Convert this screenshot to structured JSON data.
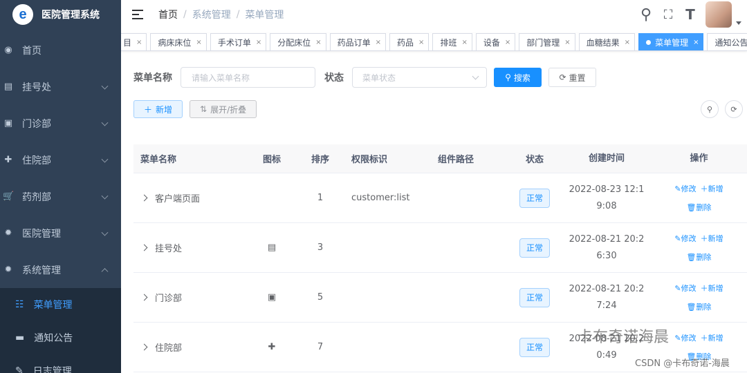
{
  "app": {
    "title": "医院管理系统",
    "logo_letter": "e"
  },
  "sidebar": {
    "items": [
      {
        "icon": "dashboard-icon",
        "glyph": "◉",
        "label": "首页"
      },
      {
        "icon": "register-icon",
        "glyph": "▤",
        "label": "挂号处"
      },
      {
        "icon": "clinic-icon",
        "glyph": "▣",
        "label": "门诊部"
      },
      {
        "icon": "hospital-icon",
        "glyph": "✚",
        "label": "住院部"
      },
      {
        "icon": "cart-icon",
        "glyph": "🛒",
        "label": "药剂部"
      },
      {
        "icon": "gear-icon",
        "glyph": "✹",
        "label": "医院管理"
      },
      {
        "icon": "gear-icon",
        "glyph": "✹",
        "label": "系统管理"
      }
    ],
    "sub_items": [
      {
        "icon": "tree-table-icon",
        "glyph": "☷",
        "label": "菜单管理"
      },
      {
        "icon": "message-icon",
        "glyph": "▬",
        "label": "通知公告"
      },
      {
        "icon": "edit-icon",
        "glyph": "✎",
        "label": "日志管理"
      }
    ]
  },
  "header": {
    "breadcrumb": [
      "首页",
      "系统管理",
      "菜单管理"
    ],
    "icons": {
      "search": "⚲",
      "fullscreen": "⛶",
      "fontsize": "T"
    }
  },
  "tags": [
    "目",
    "病床床位",
    "手术订单",
    "分配床位",
    "药品订单",
    "药品",
    "排班",
    "设备",
    "部门管理",
    "血糖结果",
    "菜单管理",
    "通知公告"
  ],
  "tags_close": "×",
  "active_tag": "菜单管理",
  "search": {
    "name_label": "菜单名称",
    "name_placeholder": "请输入菜单名称",
    "status_label": "状态",
    "status_placeholder": "菜单状态",
    "search_btn": "搜索",
    "reset_btn": "重置"
  },
  "toolbar": {
    "add": "新增",
    "expand": "展开/折叠"
  },
  "table": {
    "headers": [
      "菜单名称",
      "图标",
      "排序",
      "权限标识",
      "组件路径",
      "状态",
      "创建时间",
      "操作"
    ],
    "rows": [
      {
        "name": "客户端页面",
        "icon": "",
        "order": "1",
        "perm": "customer:list",
        "path": "",
        "status": "正常",
        "time1": "2022-08-23 12:1",
        "time2": "9:08"
      },
      {
        "name": "挂号处",
        "icon": "▤",
        "order": "3",
        "perm": "",
        "path": "",
        "status": "正常",
        "time1": "2022-08-21 20:2",
        "time2": "6:30"
      },
      {
        "name": "门诊部",
        "icon": "▣",
        "order": "5",
        "perm": "",
        "path": "",
        "status": "正常",
        "time1": "2022-08-21 20:2",
        "time2": "7:24"
      },
      {
        "name": "住院部",
        "icon": "✚",
        "order": "7",
        "perm": "",
        "path": "",
        "status": "正常",
        "time1": "2022-08-21 20:2",
        "time2": "0:49"
      }
    ],
    "ops": {
      "edit": "✎修改",
      "add": "＋新增",
      "delete": "🗑删除"
    }
  },
  "watermark": "卡布奇诺海晨",
  "credit": "CSDN @卡布奇诺-海晨"
}
